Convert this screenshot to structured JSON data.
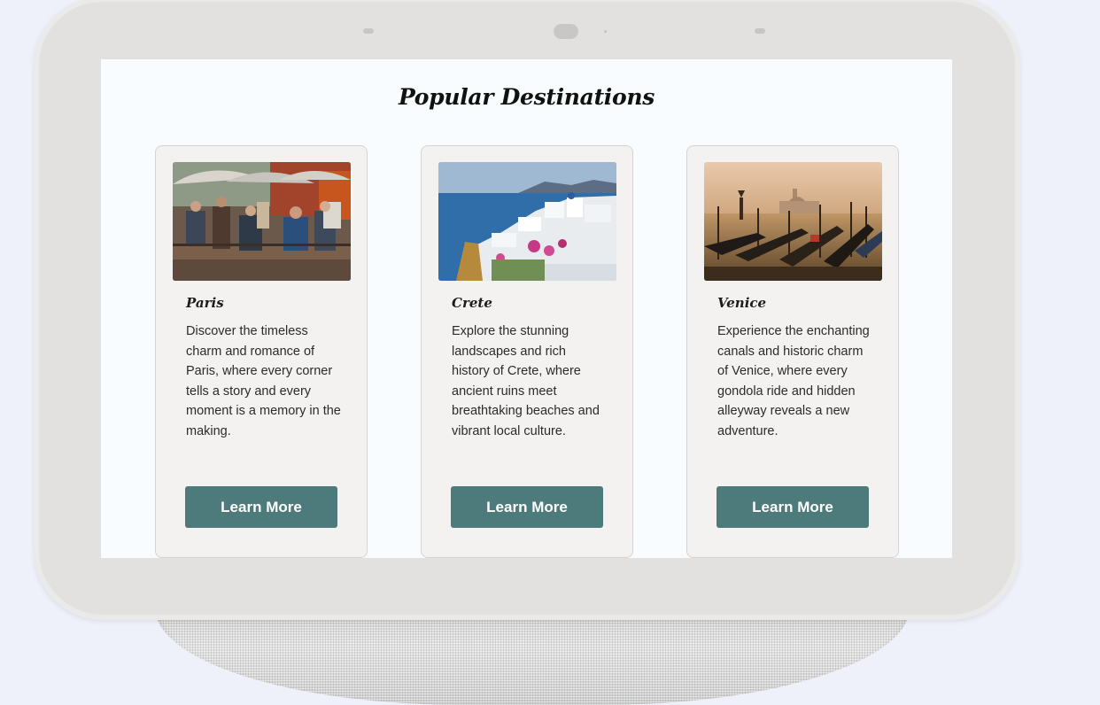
{
  "colors": {
    "background": "#eef1f9",
    "device_frame": "#e2e1e0",
    "screen": "#f8fcff",
    "card": "#f4f2f1",
    "button": "#4d7a7a",
    "button_text": "#ffffff"
  },
  "page": {
    "title": "Popular Destinations"
  },
  "destinations": [
    {
      "name": "Paris",
      "image": "paris-street-painters-photo",
      "description": "Discover the timeless charm and romance of Paris, where every corner tells a story and every moment is a memory in the making.",
      "button_label": "Learn More"
    },
    {
      "name": "Crete",
      "image": "crete-coastal-village-photo",
      "description": "Explore the stunning landscapes and rich history of Crete, where ancient ruins meet breathtaking beaches and vibrant local culture.",
      "button_label": "Learn More"
    },
    {
      "name": "Venice",
      "image": "venice-gondolas-sunset-photo",
      "description": "Experience the enchanting canals and historic charm of Venice, where every gondola ride and hidden alleyway reveals a new adventure.",
      "button_label": "Learn More"
    }
  ]
}
